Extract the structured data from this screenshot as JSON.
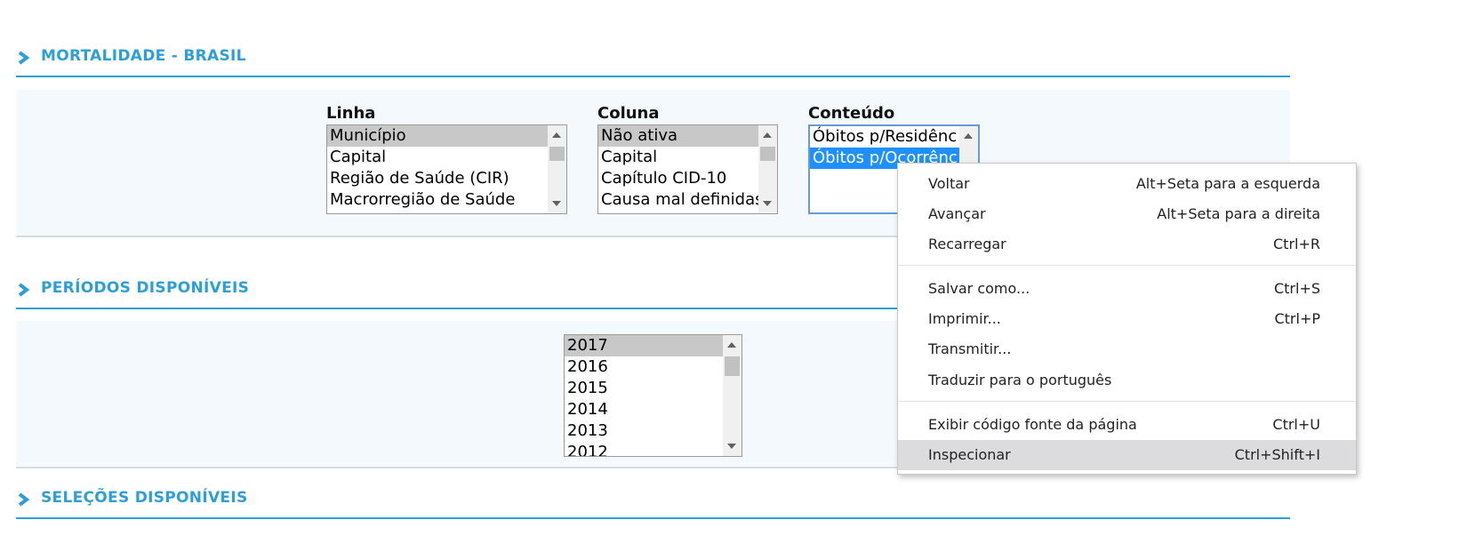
{
  "sections": {
    "mortalidade": "MORTALIDADE - BRASIL",
    "periodos": "PERÍODOS DISPONÍVEIS",
    "selecoes": "SELEÇÕES DISPONÍVEIS"
  },
  "linha": {
    "label": "Linha",
    "options": [
      "Município",
      "Capital",
      "Região de Saúde (CIR)",
      "Macrorregião de Saúde"
    ],
    "selected": "Município"
  },
  "coluna": {
    "label": "Coluna",
    "options": [
      "Não ativa",
      "Capital",
      "Capítulo CID-10",
      "Causa mal definidas"
    ],
    "selected": "Não ativa"
  },
  "conteudo": {
    "label": "Conteúdo",
    "options": [
      "Óbitos p/Residênc",
      "Óbitos p/Ocorrênc"
    ],
    "selected": "Óbitos p/Ocorrênc"
  },
  "periodos": {
    "options": [
      "2017",
      "2016",
      "2015",
      "2014",
      "2013",
      "2012"
    ],
    "selected": "2017"
  },
  "context_menu": {
    "items": [
      {
        "label": "Voltar",
        "shortcut": "Alt+Seta para a esquerda"
      },
      {
        "label": "Avançar",
        "shortcut": "Alt+Seta para a direita"
      },
      {
        "label": "Recarregar",
        "shortcut": "Ctrl+R"
      },
      {
        "label": "Salvar como...",
        "shortcut": "Ctrl+S"
      },
      {
        "label": "Imprimir...",
        "shortcut": "Ctrl+P"
      },
      {
        "label": "Transmitir...",
        "shortcut": ""
      },
      {
        "label": "Traduzir para o português",
        "shortcut": ""
      },
      {
        "label": "Exibir código fonte da página",
        "shortcut": "Ctrl+U"
      },
      {
        "label": "Inspecionar",
        "shortcut": "Ctrl+Shift+I"
      }
    ],
    "highlighted": "Inspecionar"
  },
  "colors": {
    "accent": "#2c9fd9",
    "panel_bg": "#f4f9fd",
    "selection_blue": "#1e90ff",
    "selection_gray": "#c8c8c8"
  },
  "icons": {
    "section_marker": "chevron-right-icon",
    "scroll_up": "scroll-up-arrow-icon",
    "scroll_down": "scroll-down-arrow-icon"
  }
}
